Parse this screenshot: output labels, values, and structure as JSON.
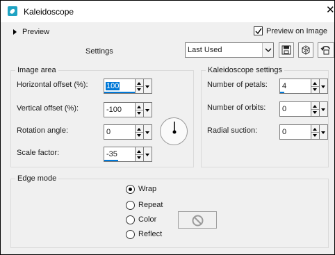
{
  "window": {
    "title": "Kaleidoscope",
    "close_glyph": "✕"
  },
  "header": {
    "preview_toggle_label": "Preview",
    "preview_on_image_label": "Preview on Image",
    "preview_on_image_checked": true
  },
  "settings": {
    "label": "Settings",
    "preset_value": "Last Used",
    "tools": [
      "save-preset-icon",
      "randomize-icon",
      "reset-icon"
    ]
  },
  "image_area": {
    "title": "Image area",
    "horizontal_offset": {
      "label": "Horizontal offset (%):",
      "value": "100"
    },
    "vertical_offset": {
      "label": "Vertical offset (%):",
      "value": "-100"
    },
    "rotation_angle": {
      "label": "Rotation angle:",
      "value": "0"
    },
    "scale_factor": {
      "label": "Scale factor:",
      "value": "-35"
    }
  },
  "kaleidoscope_settings": {
    "title": "Kaleidoscope settings",
    "number_of_petals": {
      "label": "Number of petals:",
      "value": "4"
    },
    "number_of_orbits": {
      "label": "Number of orbits:",
      "value": "0"
    },
    "radial_suction": {
      "label": "Radial suction:",
      "value": "0"
    }
  },
  "edge_mode": {
    "title": "Edge mode",
    "options": [
      "Wrap",
      "Repeat",
      "Color",
      "Reflect"
    ],
    "selected": "Wrap"
  },
  "colors": {
    "accent": "#0078d7",
    "icon_teal": "#1fa3c3"
  }
}
